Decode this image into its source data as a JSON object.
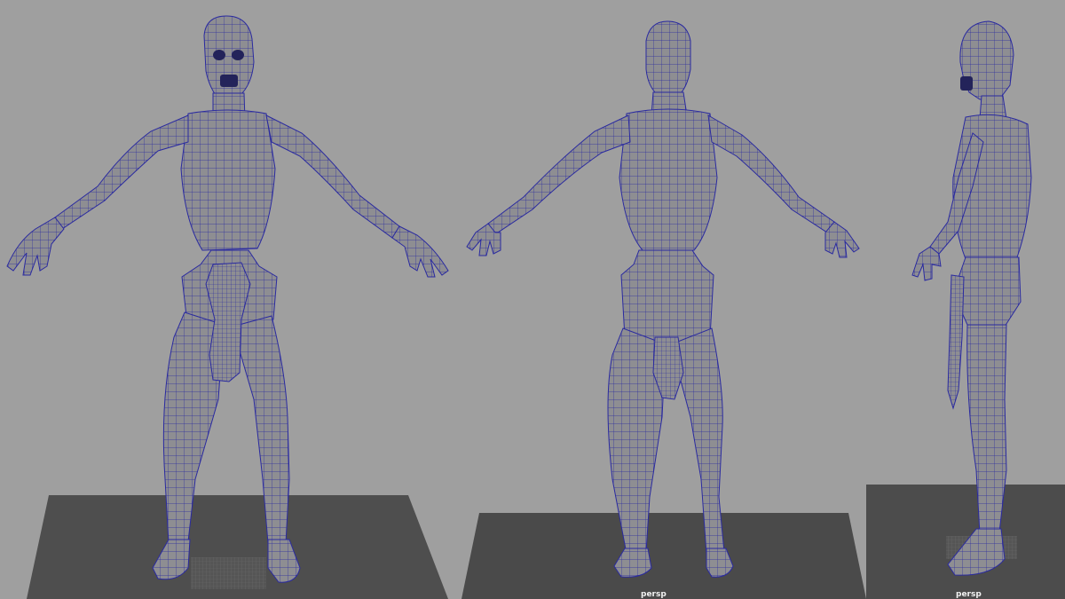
{
  "viewports": [
    {
      "id": "front",
      "camera_label": ""
    },
    {
      "id": "back",
      "camera_label": "persp"
    },
    {
      "id": "side",
      "camera_label": "persp"
    }
  ],
  "colors": {
    "background": "#9f9f9f",
    "ground": "#505050",
    "model": "#8e8e92",
    "wire": "#2a2aa0"
  }
}
